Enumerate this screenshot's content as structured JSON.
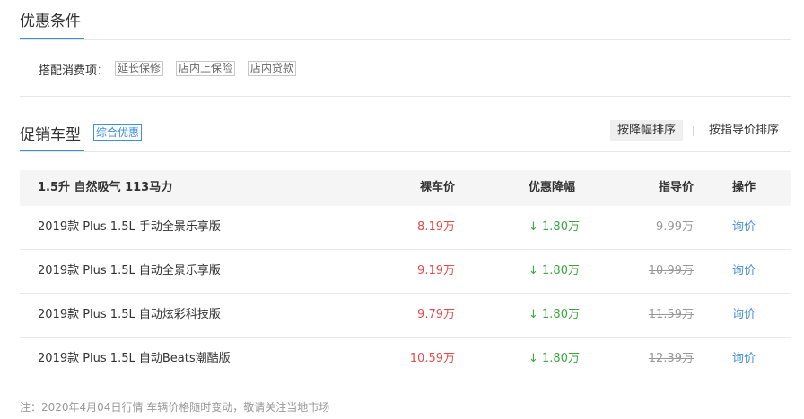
{
  "conditions": {
    "title": "优惠条件",
    "label": "搭配消费项：",
    "tags": [
      "延长保修",
      "店内上保险",
      "店内贷款"
    ]
  },
  "promo": {
    "title": "促销车型",
    "badge": "综合优惠",
    "sort_active": "按降幅排序",
    "sort_other": "按指导价排序"
  },
  "table": {
    "group": "1.5升 自然吸气 113马力",
    "col_price": "裸车价",
    "col_discount": "优惠降幅",
    "col_guide": "指导价",
    "col_action": "操作",
    "rows": [
      {
        "name": "2019款 Plus 1.5L 手动全景乐享版",
        "price": "8.19万",
        "discount": "↓ 1.80万",
        "guide": "9.99万",
        "action": "询价"
      },
      {
        "name": "2019款 Plus 1.5L 自动全景乐享版",
        "price": "9.19万",
        "discount": "↓ 1.80万",
        "guide": "10.99万",
        "action": "询价"
      },
      {
        "name": "2019款 Plus 1.5L 自动炫彩科技版",
        "price": "9.79万",
        "discount": "↓ 1.80万",
        "guide": "11.59万",
        "action": "询价"
      },
      {
        "name": "2019款 Plus 1.5L 自动Beats潮酷版",
        "price": "10.59万",
        "discount": "↓ 1.80万",
        "guide": "12.39万",
        "action": "询价"
      }
    ]
  },
  "note": "注：2020年4月04日行情 车辆价格随时变动，敬请关注当地市场",
  "colors": {
    "accent": "#3e8fe0",
    "price": "#e84a4a",
    "discount": "#3aa842",
    "link": "#4a8fd9"
  }
}
